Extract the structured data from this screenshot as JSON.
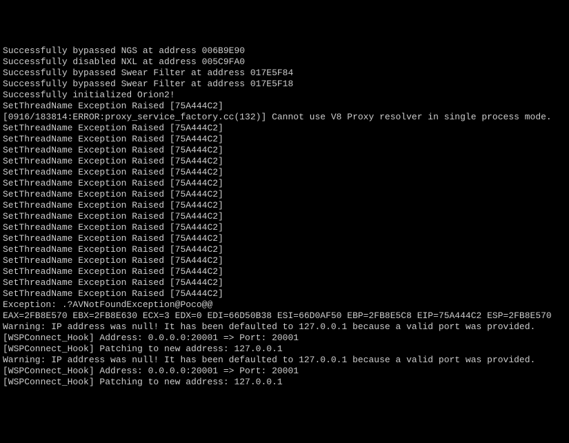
{
  "console": {
    "lines": [
      "Successfully bypassed NGS at address 006B9E90",
      "Successfully disabled NXL at address 005C9FA0",
      "Successfully bypassed Swear Filter at address 017E5F84",
      "Successfully bypassed Swear Filter at address 017E5F18",
      "Successfully initialized Orion2!",
      "SetThreadName Exception Raised [75A444C2]",
      "[0916/183814:ERROR:proxy_service_factory.cc(132)] Cannot use V8 Proxy resolver in single process mode.",
      "SetThreadName Exception Raised [75A444C2]",
      "SetThreadName Exception Raised [75A444C2]",
      "SetThreadName Exception Raised [75A444C2]",
      "SetThreadName Exception Raised [75A444C2]",
      "SetThreadName Exception Raised [75A444C2]",
      "SetThreadName Exception Raised [75A444C2]",
      "SetThreadName Exception Raised [75A444C2]",
      "SetThreadName Exception Raised [75A444C2]",
      "SetThreadName Exception Raised [75A444C2]",
      "SetThreadName Exception Raised [75A444C2]",
      "SetThreadName Exception Raised [75A444C2]",
      "SetThreadName Exception Raised [75A444C2]",
      "SetThreadName Exception Raised [75A444C2]",
      "SetThreadName Exception Raised [75A444C2]",
      "SetThreadName Exception Raised [75A444C2]",
      "SetThreadName Exception Raised [75A444C2]",
      "Exception: .?AVNotFoundException@Poco@@",
      "EAX=2FB8E570 EBX=2FB8E630 ECX=3 EDX=0 EDI=66D50B38 ESI=66D0AF50 EBP=2FB8E5C8 EIP=75A444C2 ESP=2FB8E570",
      "Warning: IP address was null! It has been defaulted to 127.0.0.1 because a valid port was provided.",
      "[WSPConnect_Hook] Address: 0.0.0.0:20001 => Port: 20001",
      "[WSPConnect_Hook] Patching to new address: 127.0.0.1",
      "Warning: IP address was null! It has been defaulted to 127.0.0.1 because a valid port was provided.",
      "[WSPConnect_Hook] Address: 0.0.0.0:20001 => Port: 20001",
      "[WSPConnect_Hook] Patching to new address: 127.0.0.1"
    ]
  }
}
